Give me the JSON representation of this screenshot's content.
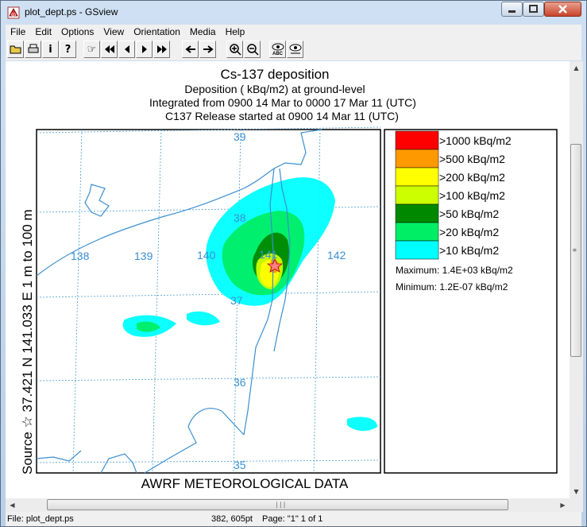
{
  "window": {
    "title": "plot_dept.ps - GSview"
  },
  "menu": [
    "File",
    "Edit",
    "Options",
    "View",
    "Orientation",
    "Media",
    "Help"
  ],
  "toolbar": [
    {
      "name": "open-button",
      "glyph": "📂"
    },
    {
      "name": "print-button",
      "glyph": "🖶"
    },
    {
      "name": "info-button",
      "glyph": "i"
    },
    {
      "name": "help-button",
      "glyph": "?"
    },
    {
      "name": "goto-page-button",
      "glyph": "☞"
    },
    {
      "name": "first-page-button",
      "glyph": "⏮"
    },
    {
      "name": "prev-page-button",
      "glyph": "◀"
    },
    {
      "name": "next-page-button",
      "glyph": "▶"
    },
    {
      "name": "last-page-button",
      "glyph": "⏭"
    },
    {
      "name": "back-button",
      "glyph": "←"
    },
    {
      "name": "forward-button",
      "glyph": "→"
    },
    {
      "name": "zoom-in-button",
      "glyph": "+"
    },
    {
      "name": "zoom-out-button",
      "glyph": "−"
    },
    {
      "name": "text-extract-button",
      "glyph": "👁"
    },
    {
      "name": "find-button",
      "glyph": "👁"
    }
  ],
  "plot": {
    "title": "Cs-137 deposition",
    "subtitle1": "Deposition  ( kBq/m2) at ground-level",
    "subtitle2": "Integrated from 0900 14 Mar to 0000 17 Mar 11 (UTC)",
    "subtitle3": "C137 Release started at 0900 14 Mar 11 (UTC)",
    "side_label": "Source ☆ 37.421  N 141.033  E      1 m to  100 m",
    "footer": "AWRF METEOROLOGICAL DATA",
    "lat_labels": [
      "39",
      "38",
      "37",
      "36",
      "35"
    ],
    "lon_labels": [
      "138",
      "139",
      "140",
      "141",
      "142"
    ]
  },
  "legend": {
    "items": [
      {
        "label": ">1000  kBq/m2",
        "color": "#ff0000"
      },
      {
        "label": ">500  kBq/m2",
        "color": "#ff9900"
      },
      {
        "label": ">200  kBq/m2",
        "color": "#ffff00"
      },
      {
        "label": ">100  kBq/m2",
        "color": "#ccff00"
      },
      {
        "label": ">50  kBq/m2",
        "color": "#008800"
      },
      {
        "label": ">20  kBq/m2",
        "color": "#00ee66"
      },
      {
        "label": ">10  kBq/m2",
        "color": "#00ffff"
      }
    ],
    "maximum": "Maximum: 1.4E+03  kBq/m2",
    "minimum": "Minimum: 1.2E-07  kBq/m2"
  },
  "status": {
    "file": "File: plot_dept.ps",
    "coords": "382, 605pt",
    "page": "Page: \"1\"  1 of 1"
  }
}
